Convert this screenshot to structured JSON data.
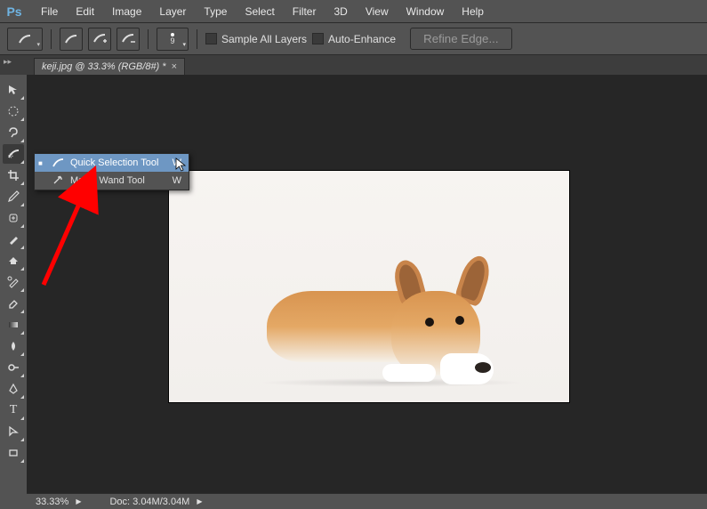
{
  "menubar": {
    "items": [
      "File",
      "Edit",
      "Image",
      "Layer",
      "Type",
      "Select",
      "Filter",
      "3D",
      "View",
      "Window",
      "Help"
    ]
  },
  "optionsbar": {
    "brush_size": "9",
    "sample_all_layers": "Sample All Layers",
    "auto_enhance": "Auto-Enhance",
    "refine_edge": "Refine Edge..."
  },
  "tab": {
    "title": "keji.jpg @ 33.3% (RGB/8#) *",
    "close": "×"
  },
  "flyout": {
    "items": [
      {
        "label": "Quick Selection Tool",
        "shortcut": "W",
        "selected": true
      },
      {
        "label": "Magic Wand Tool",
        "shortcut": "W",
        "selected": false
      }
    ]
  },
  "statusbar": {
    "zoom": "33.33%",
    "doc": "Doc: 3.04M/3.04M"
  }
}
